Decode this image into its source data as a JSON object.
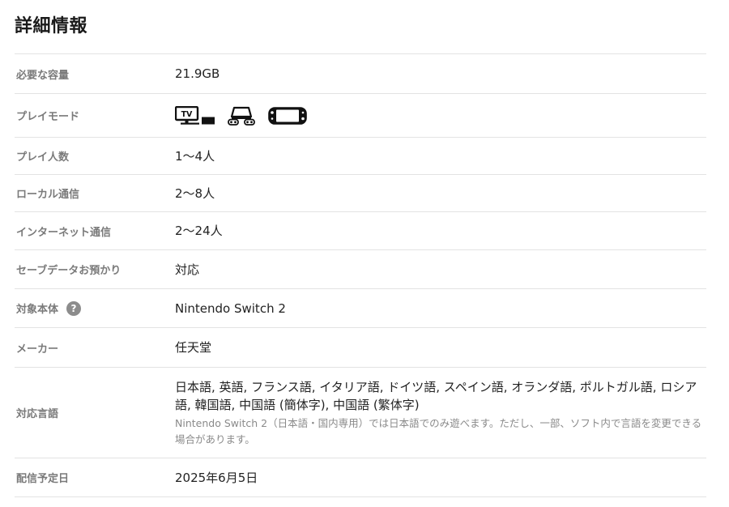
{
  "section_title": "詳細情報",
  "rows": {
    "capacity": {
      "label": "必要な容量",
      "value": "21.9GB"
    },
    "play_mode": {
      "label": "プレイモード",
      "modes": [
        {
          "icon": "tv-mode-icon",
          "tv_text": "TV"
        },
        {
          "icon": "tabletop-mode-icon"
        },
        {
          "icon": "handheld-mode-icon"
        }
      ]
    },
    "players": {
      "label": "プレイ人数",
      "value": "1〜4人"
    },
    "local": {
      "label": "ローカル通信",
      "value": "2〜8人"
    },
    "internet": {
      "label": "インターネット通信",
      "value": "2〜24人"
    },
    "save_data": {
      "label": "セーブデータお預かり",
      "value": "対応"
    },
    "target": {
      "label": "対象本体",
      "help_icon": "?",
      "value": "Nintendo Switch 2"
    },
    "maker": {
      "label": "メーカー",
      "value": "任天堂"
    },
    "languages": {
      "label": "対応言語",
      "value": "日本語, 英語, フランス語, イタリア語, ドイツ語, スペイン語, オランダ語, ポルトガル語, ロシア語, 韓国語, 中国語 (簡体字), 中国語 (繁体字)",
      "note": "Nintendo Switch 2（日本語・国内専用）では日本語でのみ遊べます。ただし、一部、ソフト内で言語を変更できる場合があります。"
    },
    "release": {
      "label": "配信予定日",
      "value": "2025年6月5日"
    }
  }
}
